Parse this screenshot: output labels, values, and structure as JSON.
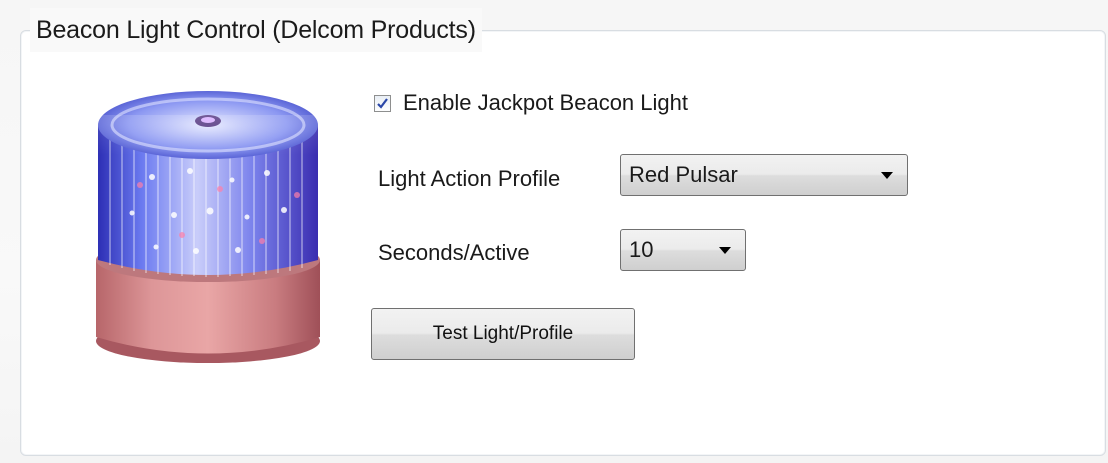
{
  "group": {
    "title": "Beacon Light Control (Delcom Products)"
  },
  "beacon": {
    "enabled": true,
    "enable_label": "Enable Jackpot Beacon Light"
  },
  "profile": {
    "label": "Light Action Profile",
    "selected": "Red Pulsar"
  },
  "seconds": {
    "label": "Seconds/Active",
    "selected": "10"
  },
  "test_button": {
    "label": "Test Light/Profile"
  },
  "icons": {
    "beacon_image": "beacon-light-icon",
    "checkbox": "checkmark-icon",
    "dropdown": "chevron-down-icon"
  }
}
